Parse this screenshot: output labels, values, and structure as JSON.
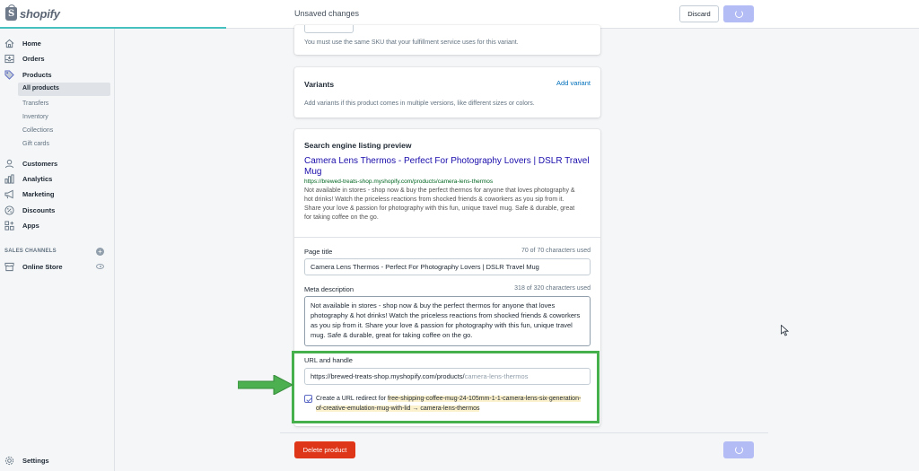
{
  "brand": {
    "name": "shopify",
    "accent_color": "#47c1bf"
  },
  "topbar": {
    "title": "Unsaved changes",
    "discard_label": "Discard"
  },
  "sidebar": {
    "items": [
      {
        "label": "Home",
        "icon": "home-icon"
      },
      {
        "label": "Orders",
        "icon": "orders-icon"
      },
      {
        "label": "Products",
        "icon": "tag-icon"
      },
      {
        "label": "Customers",
        "icon": "person-icon"
      },
      {
        "label": "Analytics",
        "icon": "bar-chart-icon"
      },
      {
        "label": "Marketing",
        "icon": "megaphone-icon"
      },
      {
        "label": "Discounts",
        "icon": "discount-icon"
      },
      {
        "label": "Apps",
        "icon": "apps-icon"
      }
    ],
    "product_subitems": [
      "All products",
      "Transfers",
      "Inventory",
      "Collections",
      "Gift cards"
    ],
    "sales_channels_heading": "SALES CHANNELS",
    "online_store": "Online Store",
    "settings": "Settings"
  },
  "sku_card": {
    "note": "You must use the same SKU that your fulfillment service uses for this variant."
  },
  "variants_card": {
    "title": "Variants",
    "add_label": "Add variant",
    "description": "Add variants if this product comes in multiple versions, like different sizes or colors."
  },
  "seo_card": {
    "title": "Search engine listing preview",
    "preview_title": "Camera Lens Thermos - Perfect For Photography Lovers | DSLR Travel Mug",
    "preview_url": "https://brewed-treats-shop.myshopify.com/products/camera-lens-thermos",
    "preview_description": "Not available in stores - shop now & buy the perfect thermos for anyone that loves photography & hot drinks! Watch the priceless reactions from shocked friends & coworkers as you sip from it. Share your love & passion for photography with this fun, unique travel mug. Safe & durable, great for taking coffee on the go.",
    "page_title_label": "Page title",
    "page_title_count": "70 of 70 characters used",
    "page_title_value": "Camera Lens Thermos - Perfect For Photography Lovers | DSLR Travel Mug",
    "meta_label": "Meta description",
    "meta_count": "318 of 320 characters used",
    "meta_value": "Not available in stores - shop now & buy the perfect thermos for anyone that loves photography & hot drinks! Watch the priceless reactions from shocked friends & coworkers as you sip from it. Share your love & passion for photography with this fun, unique travel mug. Safe & durable, great for taking coffee on the go.",
    "url_label": "URL and handle",
    "url_prefix": "https://brewed-treats-shop.myshopify.com/products/",
    "url_handle": "camera-lens-thermos",
    "redirect_prefix": "Create a URL redirect for ",
    "redirect_from": "free-shipping-coffee-mug-24-105mm-1-1-camera-lens-six-generation-of-creative-emulation-mug-with-lid",
    "redirect_arrow": " → ",
    "redirect_to": "camera-lens-thermos",
    "redirect_checked": true
  },
  "footer": {
    "delete_label": "Delete product"
  },
  "colors": {
    "primary_disabled": "#b3bcf5",
    "danger": "#de3618",
    "highlight_border": "#46b04c",
    "arrow": "#4caf50"
  }
}
